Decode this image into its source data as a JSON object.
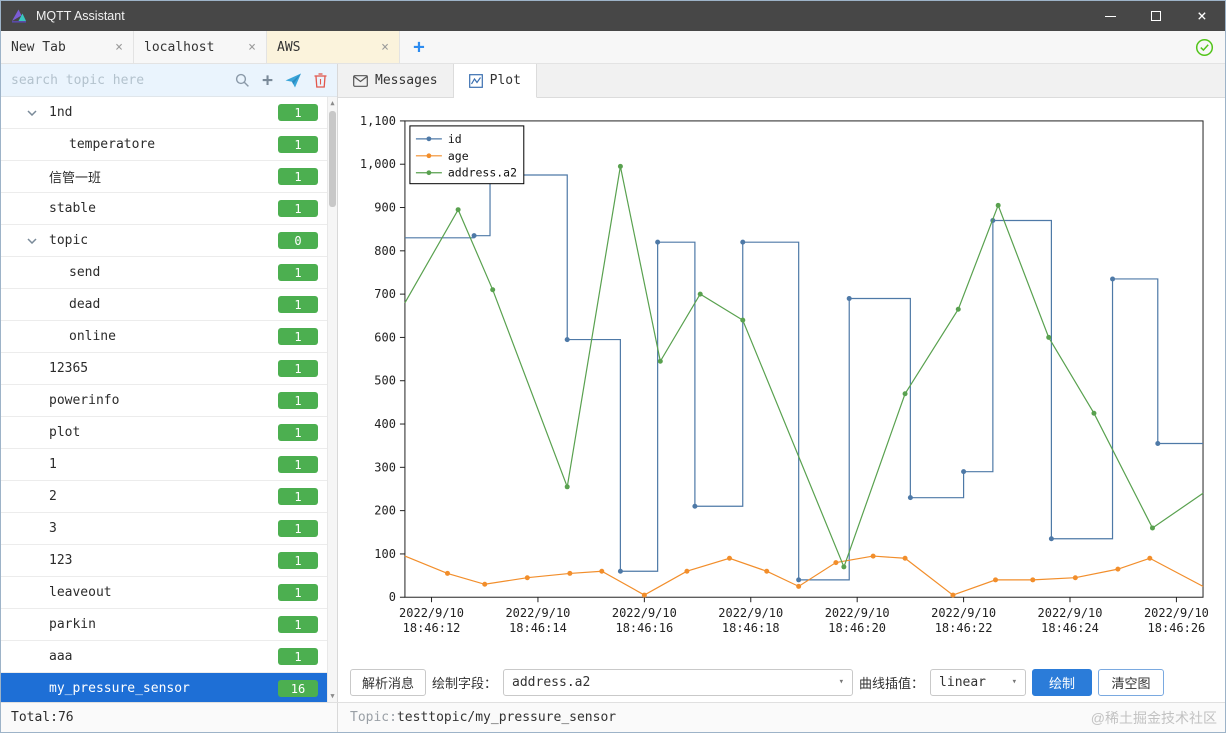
{
  "window": {
    "title": "MQTT Assistant"
  },
  "icons": {
    "tab_close": "×",
    "window_close": "×",
    "add_tab": "+",
    "search_plus": "+",
    "dropdown_caret": "▾",
    "scroll_up": "▲",
    "scroll_down": "▼"
  },
  "colors": {
    "badge_green": "#4caf50",
    "selected_row_blue": "#1e6fd6",
    "primary_button_blue": "#2b7cd9",
    "connected_green": "#52c41a",
    "trash_red": "#e2574c",
    "send_teal": "#3aa5d9"
  },
  "browser_tabs": [
    {
      "label": "New Tab",
      "active": false
    },
    {
      "label": "localhost",
      "active": false
    },
    {
      "label": "AWS",
      "active": true
    }
  ],
  "sidebar": {
    "search_placeholder": "search topic here",
    "topics": [
      {
        "label": "1nd",
        "badge": "1",
        "level": 0,
        "expandable": true,
        "selected": false
      },
      {
        "label": "temperatore",
        "badge": "1",
        "level": 1,
        "expandable": false,
        "selected": false
      },
      {
        "label": "信管一班",
        "badge": "1",
        "level": 0,
        "expandable": false,
        "selected": false
      },
      {
        "label": "stable",
        "badge": "1",
        "level": 0,
        "expandable": false,
        "selected": false
      },
      {
        "label": "topic",
        "badge": "0",
        "level": 0,
        "expandable": true,
        "selected": false
      },
      {
        "label": "send",
        "badge": "1",
        "level": 1,
        "expandable": false,
        "selected": false
      },
      {
        "label": "dead",
        "badge": "1",
        "level": 1,
        "expandable": false,
        "selected": false
      },
      {
        "label": "online",
        "badge": "1",
        "level": 1,
        "expandable": false,
        "selected": false
      },
      {
        "label": "12365",
        "badge": "1",
        "level": 0,
        "expandable": false,
        "selected": false
      },
      {
        "label": "powerinfo",
        "badge": "1",
        "level": 0,
        "expandable": false,
        "selected": false
      },
      {
        "label": "plot",
        "badge": "1",
        "level": 0,
        "expandable": false,
        "selected": false
      },
      {
        "label": "1",
        "badge": "1",
        "level": 0,
        "expandable": false,
        "selected": false
      },
      {
        "label": "2",
        "badge": "1",
        "level": 0,
        "expandable": false,
        "selected": false
      },
      {
        "label": "3",
        "badge": "1",
        "level": 0,
        "expandable": false,
        "selected": false
      },
      {
        "label": "123",
        "badge": "1",
        "level": 0,
        "expandable": false,
        "selected": false
      },
      {
        "label": "leaveout",
        "badge": "1",
        "level": 0,
        "expandable": false,
        "selected": false
      },
      {
        "label": "parkin",
        "badge": "1",
        "level": 0,
        "expandable": false,
        "selected": false
      },
      {
        "label": "aaa",
        "badge": "1",
        "level": 0,
        "expandable": false,
        "selected": false
      },
      {
        "label": "my_pressure_sensor",
        "badge": "16",
        "level": 0,
        "expandable": false,
        "selected": true
      }
    ],
    "total": "Total:76"
  },
  "main": {
    "tabs": [
      {
        "label": "Messages",
        "active": false
      },
      {
        "label": "Plot",
        "active": true
      }
    ],
    "controls": {
      "parse_button": "解析消息",
      "field_label": "绘制字段：",
      "field_value": "address.a2",
      "interp_label": "曲线插值：",
      "interp_value": "linear",
      "draw_button": "绘制",
      "clear_button": "清空图"
    },
    "statusbar": {
      "topic_label": "Topic:",
      "topic_value": "testtopic/my_pressure_sensor",
      "watermark": "@稀土掘金技术社区"
    }
  },
  "chart_data": {
    "type": "line",
    "title": "",
    "xlabel": "",
    "ylabel": "",
    "legend_position": "top-left",
    "grid": false,
    "ylim": [
      0,
      1100
    ],
    "y_ticks": [
      0,
      100,
      200,
      300,
      400,
      500,
      600,
      700,
      800,
      900,
      1000,
      1100
    ],
    "x_range": [
      11.5,
      26.5
    ],
    "x_ticks": [
      {
        "t": 12,
        "date": "2022/9/10",
        "time": "18:46:12"
      },
      {
        "t": 14,
        "date": "2022/9/10",
        "time": "18:46:14"
      },
      {
        "t": 16,
        "date": "2022/9/10",
        "time": "18:46:16"
      },
      {
        "t": 18,
        "date": "2022/9/10",
        "time": "18:46:18"
      },
      {
        "t": 20,
        "date": "2022/9/10",
        "time": "18:46:20"
      },
      {
        "t": 22,
        "date": "2022/9/10",
        "time": "18:46:22"
      },
      {
        "t": 24,
        "date": "2022/9/10",
        "time": "18:46:24"
      },
      {
        "t": 26,
        "date": "2022/9/10",
        "time": "18:46:26"
      }
    ],
    "series": [
      {
        "name": "id",
        "color": "#4e79a7",
        "interpolation": "step",
        "points": [
          [
            11.5,
            830
          ],
          [
            12.8,
            835
          ],
          [
            13.1,
            975
          ],
          [
            14.55,
            595
          ],
          [
            15.55,
            60
          ],
          [
            16.25,
            820
          ],
          [
            16.95,
            210
          ],
          [
            17.85,
            820
          ],
          [
            18.9,
            40
          ],
          [
            19.85,
            690
          ],
          [
            21.0,
            230
          ],
          [
            22.0,
            290
          ],
          [
            22.55,
            870
          ],
          [
            23.65,
            135
          ],
          [
            24.8,
            735
          ],
          [
            25.65,
            355
          ],
          [
            26.5,
            355
          ]
        ]
      },
      {
        "name": "age",
        "color": "#f28e2b",
        "interpolation": "linear",
        "points": [
          [
            11.5,
            95
          ],
          [
            12.3,
            55
          ],
          [
            13.0,
            30
          ],
          [
            13.8,
            45
          ],
          [
            14.6,
            55
          ],
          [
            15.2,
            60
          ],
          [
            16.0,
            5
          ],
          [
            16.8,
            60
          ],
          [
            17.6,
            90
          ],
          [
            18.3,
            60
          ],
          [
            18.9,
            25
          ],
          [
            19.6,
            80
          ],
          [
            20.3,
            95
          ],
          [
            20.9,
            90
          ],
          [
            21.8,
            5
          ],
          [
            22.6,
            40
          ],
          [
            23.3,
            40
          ],
          [
            24.1,
            45
          ],
          [
            24.9,
            65
          ],
          [
            25.5,
            90
          ],
          [
            26.5,
            25
          ]
        ]
      },
      {
        "name": "address.a2",
        "color": "#59a14f",
        "interpolation": "linear",
        "points": [
          [
            11.5,
            680
          ],
          [
            12.5,
            895
          ],
          [
            13.15,
            710
          ],
          [
            14.55,
            255
          ],
          [
            15.55,
            995
          ],
          [
            16.3,
            545
          ],
          [
            17.05,
            700
          ],
          [
            17.85,
            640
          ],
          [
            19.75,
            70
          ],
          [
            20.9,
            470
          ],
          [
            21.9,
            665
          ],
          [
            22.65,
            905
          ],
          [
            23.6,
            600
          ],
          [
            24.45,
            425
          ],
          [
            25.55,
            160
          ],
          [
            26.5,
            240
          ]
        ]
      }
    ]
  }
}
